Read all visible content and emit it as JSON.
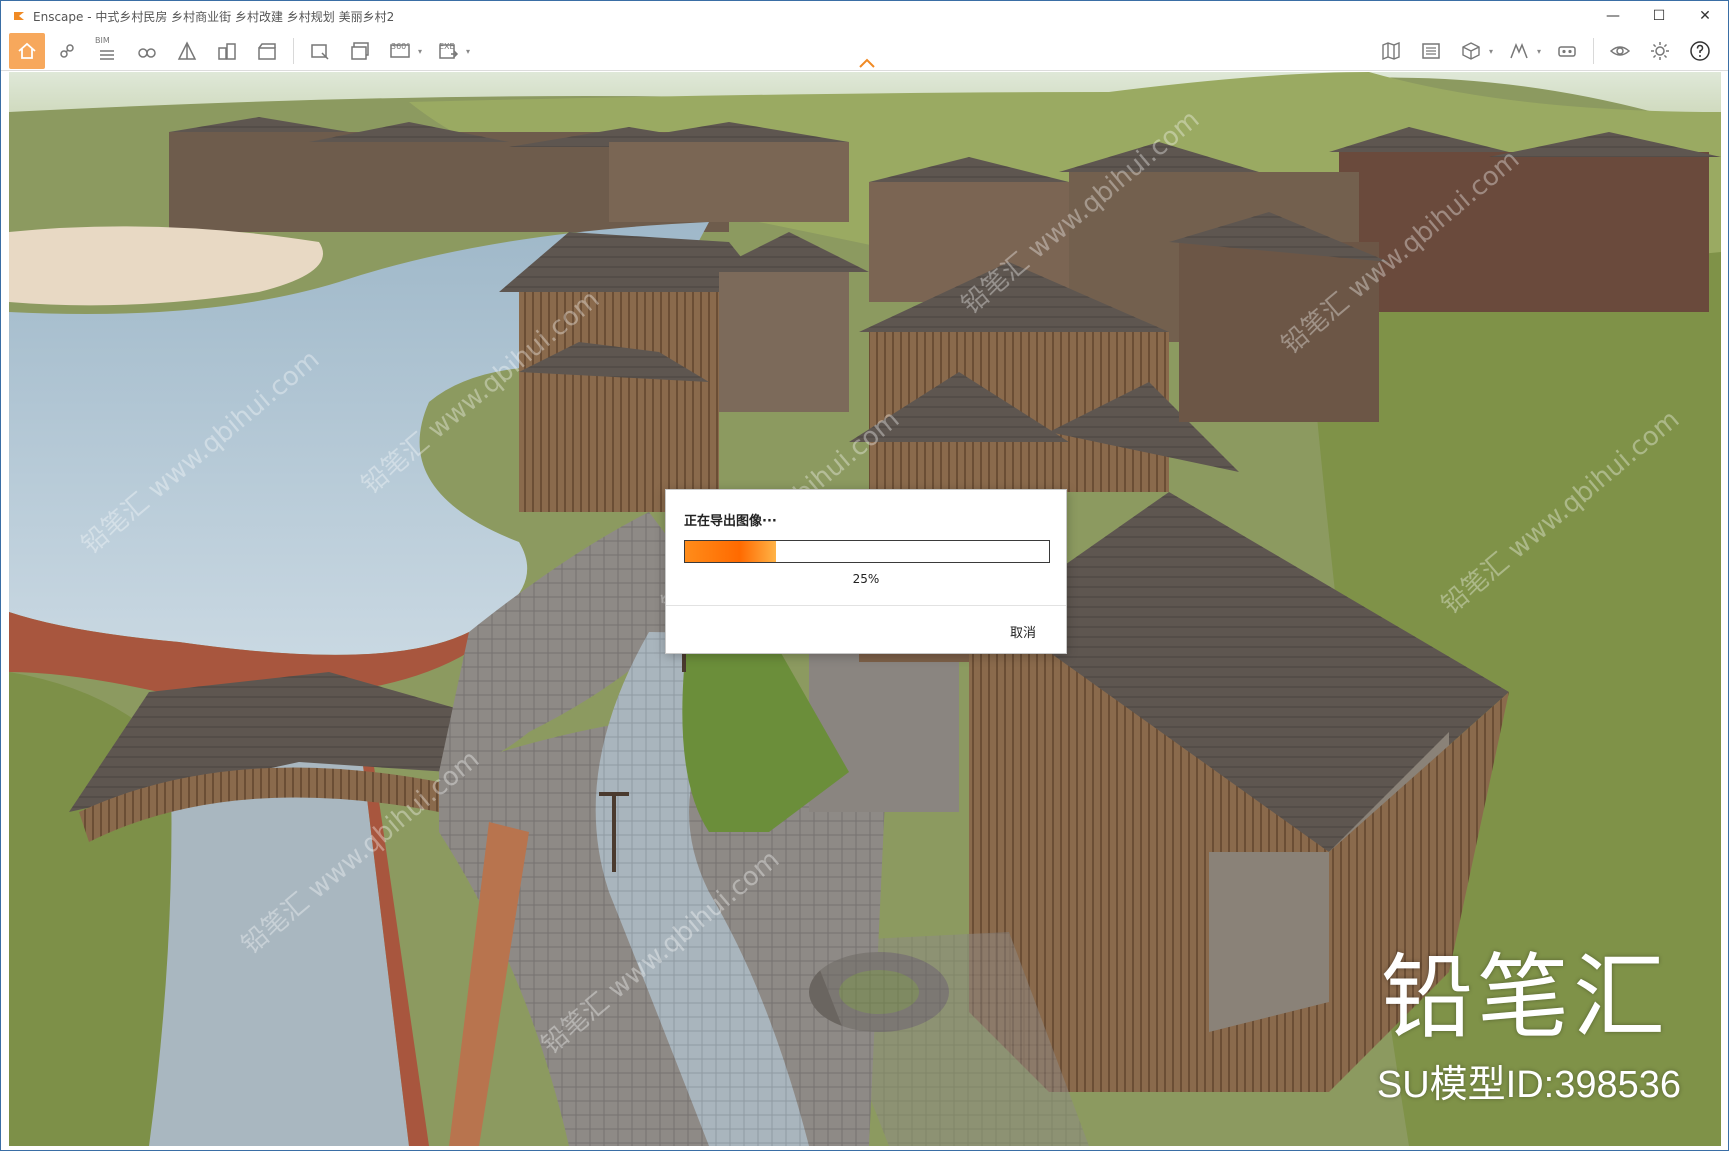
{
  "window": {
    "app_name": "Enscape",
    "title": "Enscape - 中式乡村民房 乡村商业街 乡村改建 乡村规划 美丽乡村2",
    "controls": {
      "minimize": "—",
      "maximize": "☐",
      "close": "✕"
    }
  },
  "toolbar": {
    "bim_label": "BIM",
    "panorama_label": "360°",
    "exe_label": "EXE",
    "icons_left": [
      "home-icon",
      "link-icon",
      "bim-list-icon",
      "binoculars-icon",
      "perspective-icon",
      "buildings-icon",
      "video-icon"
    ],
    "icons_export": [
      "screenshot-export-icon",
      "batch-render-icon",
      "panorama-icon",
      "exe-export-icon"
    ],
    "icons_right": [
      "map-icon",
      "asset-library-icon",
      "cube-icon",
      "atlas-icon",
      "headset-icon",
      "eye-icon",
      "gear-icon",
      "help-icon"
    ]
  },
  "dialog": {
    "title": "正在导出图像···",
    "progress": 0.25,
    "progress_text": "25%",
    "cancel_label": "取消"
  },
  "watermark": {
    "brand": "铅笔汇",
    "model_id": "SU模型ID:398536",
    "repeat_text": "铅笔汇 www.qbihui.com"
  },
  "colors": {
    "accent": "#f7a85c",
    "progress_start": "#ff8c1a",
    "progress_end": "#ffb347",
    "window_border": "#3a6ea5"
  }
}
